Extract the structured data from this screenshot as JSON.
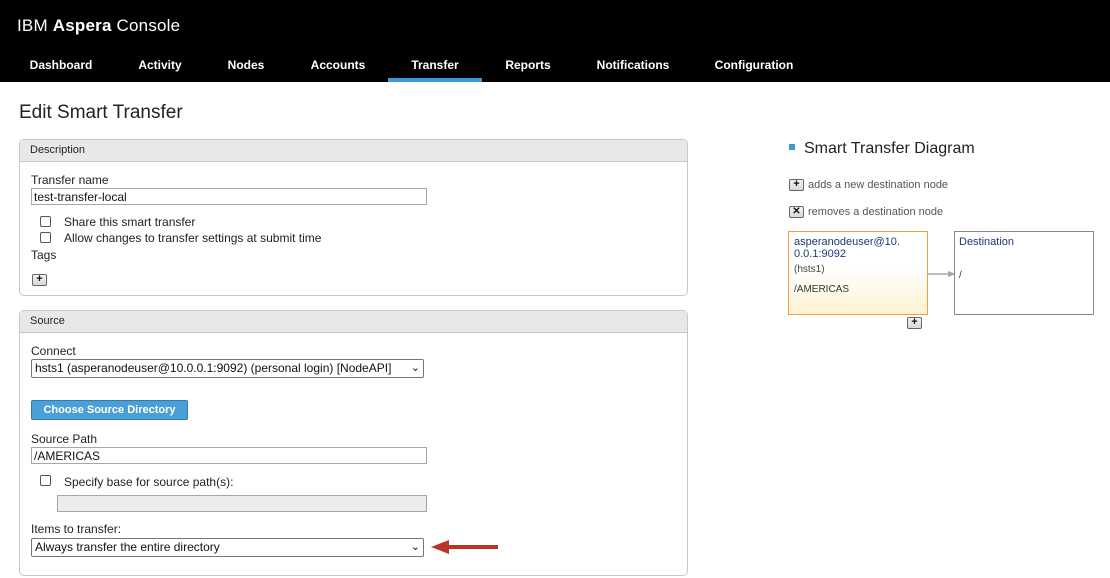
{
  "app": {
    "brand_light": "IBM",
    "brand_bold": "Aspera",
    "brand_tail": "Console"
  },
  "nav": {
    "items": [
      {
        "label": "Dashboard"
      },
      {
        "label": "Activity"
      },
      {
        "label": "Nodes"
      },
      {
        "label": "Accounts"
      },
      {
        "label": "Transfer",
        "active": true
      },
      {
        "label": "Reports"
      },
      {
        "label": "Notifications"
      },
      {
        "label": "Configuration"
      }
    ]
  },
  "page": {
    "title": "Edit Smart Transfer"
  },
  "description": {
    "header": "Description",
    "transfer_name_label": "Transfer name",
    "transfer_name_value": "test-transfer-local",
    "share_label": "Share this smart transfer",
    "allow_changes_label": "Allow changes to transfer settings at submit time",
    "tags_label": "Tags",
    "add_tag_symbol": "+"
  },
  "source": {
    "header": "Source",
    "connect_label": "Connect",
    "connect_value": "hsts1 (asperanodeuser@10.0.0.1:9092) (personal login) [NodeAPI]",
    "choose_button": "Choose Source Directory",
    "source_path_label": "Source Path",
    "source_path_value": "/AMERICAS",
    "specify_base_label": "Specify base for source path(s):",
    "items_label": "Items to transfer:",
    "items_value": "Always transfer the entire directory"
  },
  "diagram": {
    "title": "Smart Transfer Diagram",
    "add_legend": "adds a new destination node",
    "remove_legend": "removes a destination node",
    "add_symbol": "+",
    "remove_symbol": "✕",
    "source_node": {
      "line1": "asperanodeuser@10.",
      "line2": "0.0.1:9092",
      "node": "(hsts1)",
      "path": "/AMERICAS"
    },
    "dest_node": {
      "title": "Destination",
      "path": "/"
    }
  },
  "colors": {
    "header_bg": "#000000",
    "active_tab_underline": "#3d99d6",
    "button_blue": "#4a9fd6",
    "annotation_arrow": "#b8352a",
    "source_node_border": "#f0a040"
  }
}
